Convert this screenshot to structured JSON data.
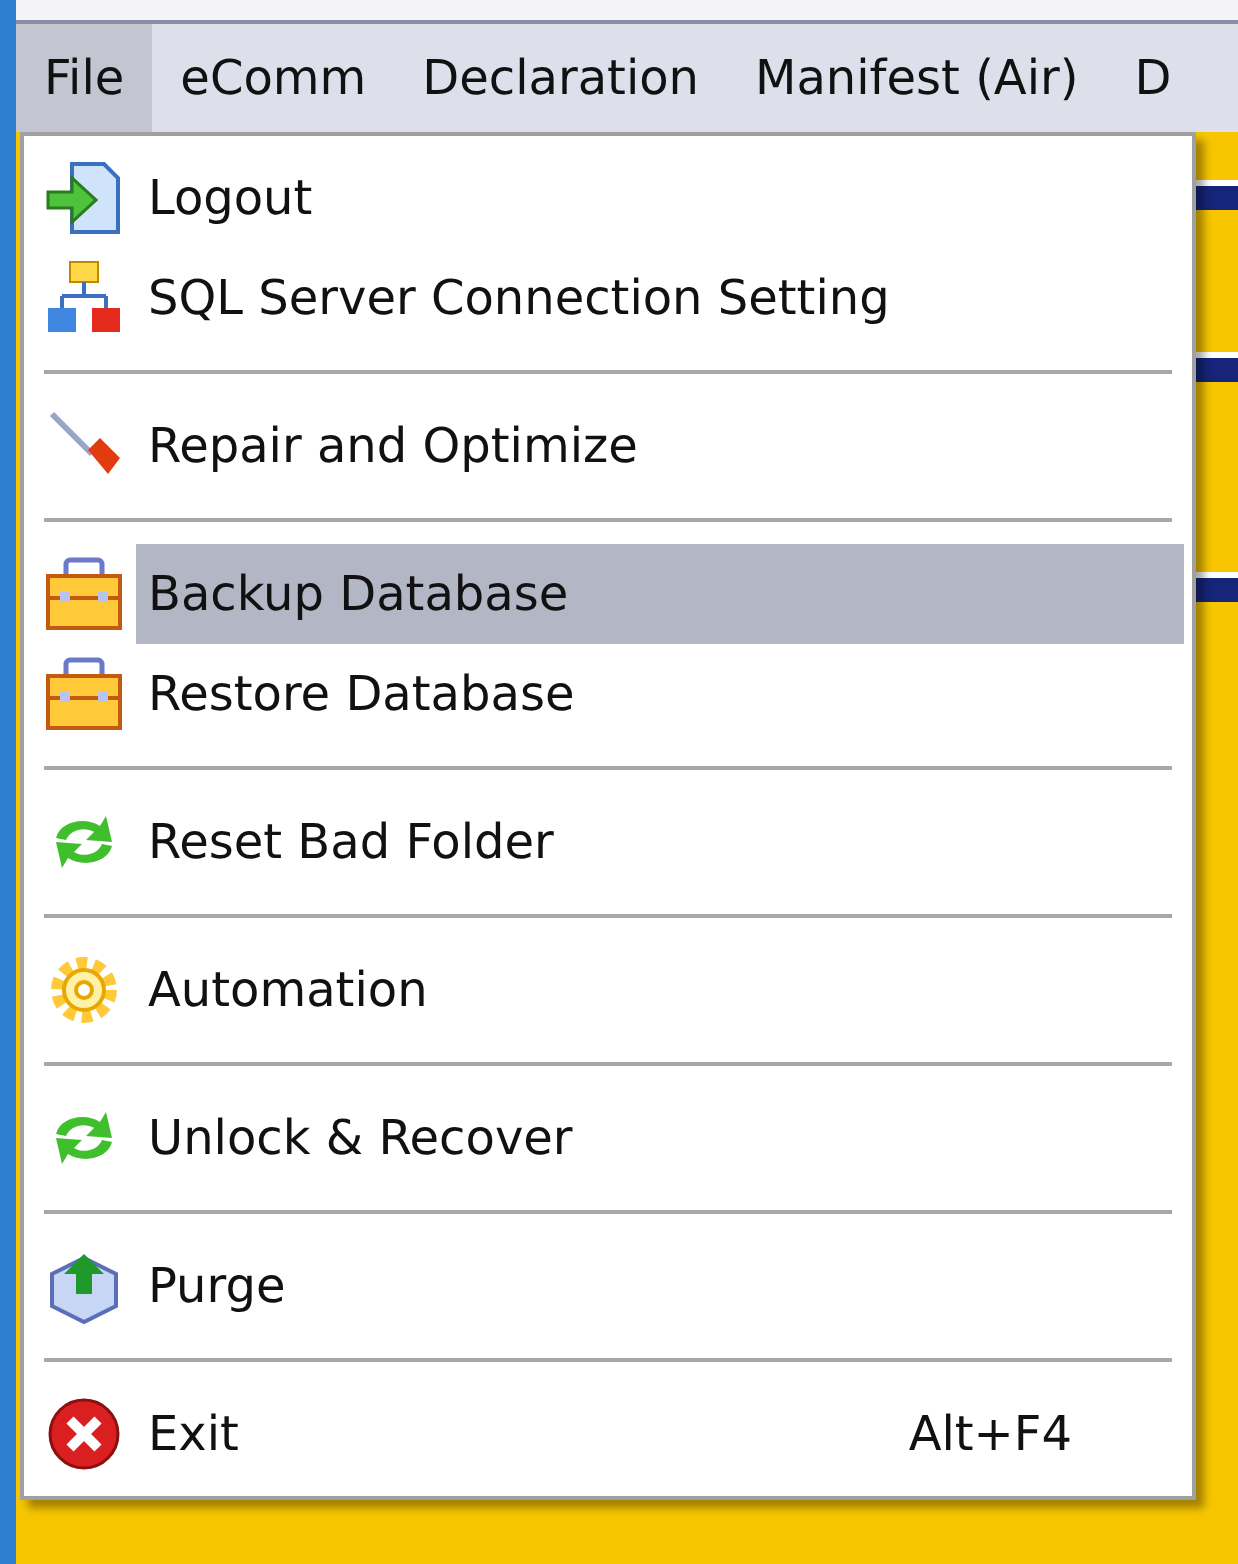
{
  "menu_bar": [
    {
      "label": "File",
      "selected": true
    },
    {
      "label": "eComm",
      "selected": false
    },
    {
      "label": "Declaration",
      "selected": false
    },
    {
      "label": "Manifest (Air)",
      "selected": false
    },
    {
      "label": "D",
      "selected": false
    }
  ],
  "file_menu": [
    {
      "kind": "item",
      "label": "Logout",
      "selected": false
    },
    {
      "kind": "item",
      "label": "SQL Server Connection Setting",
      "selected": false
    },
    {
      "kind": "separator"
    },
    {
      "kind": "item",
      "label": "Repair and Optimize",
      "selected": false
    },
    {
      "kind": "separator"
    },
    {
      "kind": "item",
      "label": "Backup Database",
      "selected": true
    },
    {
      "kind": "item",
      "label": "Restore Database",
      "selected": false
    },
    {
      "kind": "separator"
    },
    {
      "kind": "item",
      "label": "Reset Bad Folder",
      "selected": false
    },
    {
      "kind": "separator"
    },
    {
      "kind": "item",
      "label": "Automation",
      "selected": false
    },
    {
      "kind": "separator"
    },
    {
      "kind": "item",
      "label": "Unlock & Recover",
      "selected": false
    },
    {
      "kind": "separator"
    },
    {
      "kind": "item",
      "label": "Purge",
      "selected": false
    },
    {
      "kind": "separator"
    },
    {
      "kind": "item",
      "label": "Exit",
      "shortcut": "Alt+F4",
      "selected": false
    }
  ]
}
